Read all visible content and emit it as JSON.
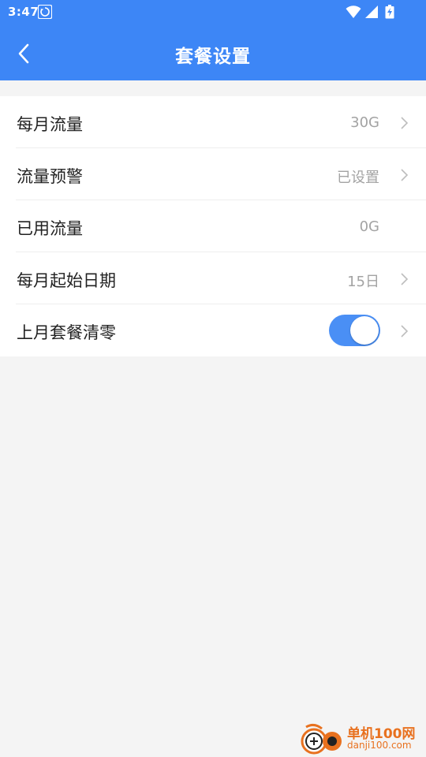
{
  "status_bar": {
    "time": "3:47",
    "app_icon": "sync-notification-icon",
    "wifi_icon": "wifi-icon",
    "signal_icon": "signal-icon",
    "battery_icon": "battery-charging-icon"
  },
  "header": {
    "title": "套餐设置",
    "back_icon": "back-chevron-icon",
    "background": "#3d86f6"
  },
  "settings": [
    {
      "label": "每月流量",
      "value": "30G",
      "has_chevron": true
    },
    {
      "label": "流量预警",
      "value": "已设置",
      "has_chevron": true
    },
    {
      "label": "已用流量",
      "value": "0G",
      "has_chevron": false
    },
    {
      "label": "每月起始日期",
      "value": "15日",
      "has_chevron": true
    },
    {
      "label": "上月套餐清零",
      "toggle": "on",
      "has_chevron": true
    }
  ],
  "toggle_color": "#4a8ff5",
  "watermark": {
    "name": "单机100网",
    "domain": "danji100.com",
    "color": "#e8711f"
  }
}
